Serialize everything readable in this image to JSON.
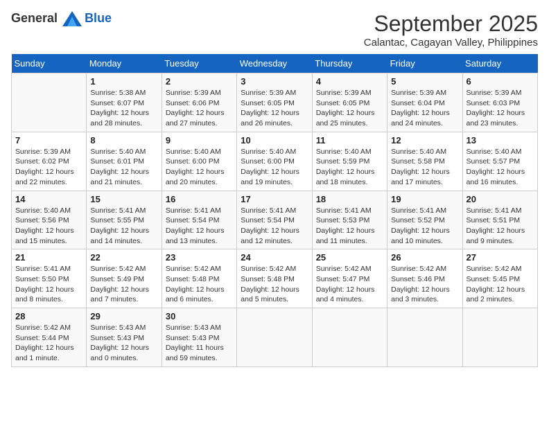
{
  "logo": {
    "line1": "General",
    "line2": "Blue"
  },
  "title": "September 2025",
  "subtitle": "Calantac, Cagayan Valley, Philippines",
  "days_of_week": [
    "Sunday",
    "Monday",
    "Tuesday",
    "Wednesday",
    "Thursday",
    "Friday",
    "Saturday"
  ],
  "weeks": [
    [
      null,
      {
        "day": 1,
        "sunrise": "5:38 AM",
        "sunset": "6:07 PM",
        "daylight": "12 hours and 28 minutes."
      },
      {
        "day": 2,
        "sunrise": "5:39 AM",
        "sunset": "6:06 PM",
        "daylight": "12 hours and 27 minutes."
      },
      {
        "day": 3,
        "sunrise": "5:39 AM",
        "sunset": "6:05 PM",
        "daylight": "12 hours and 26 minutes."
      },
      {
        "day": 4,
        "sunrise": "5:39 AM",
        "sunset": "6:05 PM",
        "daylight": "12 hours and 25 minutes."
      },
      {
        "day": 5,
        "sunrise": "5:39 AM",
        "sunset": "6:04 PM",
        "daylight": "12 hours and 24 minutes."
      },
      {
        "day": 6,
        "sunrise": "5:39 AM",
        "sunset": "6:03 PM",
        "daylight": "12 hours and 23 minutes."
      }
    ],
    [
      {
        "day": 7,
        "sunrise": "5:39 AM",
        "sunset": "6:02 PM",
        "daylight": "12 hours and 22 minutes."
      },
      {
        "day": 8,
        "sunrise": "5:40 AM",
        "sunset": "6:01 PM",
        "daylight": "12 hours and 21 minutes."
      },
      {
        "day": 9,
        "sunrise": "5:40 AM",
        "sunset": "6:00 PM",
        "daylight": "12 hours and 20 minutes."
      },
      {
        "day": 10,
        "sunrise": "5:40 AM",
        "sunset": "6:00 PM",
        "daylight": "12 hours and 19 minutes."
      },
      {
        "day": 11,
        "sunrise": "5:40 AM",
        "sunset": "5:59 PM",
        "daylight": "12 hours and 18 minutes."
      },
      {
        "day": 12,
        "sunrise": "5:40 AM",
        "sunset": "5:58 PM",
        "daylight": "12 hours and 17 minutes."
      },
      {
        "day": 13,
        "sunrise": "5:40 AM",
        "sunset": "5:57 PM",
        "daylight": "12 hours and 16 minutes."
      }
    ],
    [
      {
        "day": 14,
        "sunrise": "5:40 AM",
        "sunset": "5:56 PM",
        "daylight": "12 hours and 15 minutes."
      },
      {
        "day": 15,
        "sunrise": "5:41 AM",
        "sunset": "5:55 PM",
        "daylight": "12 hours and 14 minutes."
      },
      {
        "day": 16,
        "sunrise": "5:41 AM",
        "sunset": "5:54 PM",
        "daylight": "12 hours and 13 minutes."
      },
      {
        "day": 17,
        "sunrise": "5:41 AM",
        "sunset": "5:54 PM",
        "daylight": "12 hours and 12 minutes."
      },
      {
        "day": 18,
        "sunrise": "5:41 AM",
        "sunset": "5:53 PM",
        "daylight": "12 hours and 11 minutes."
      },
      {
        "day": 19,
        "sunrise": "5:41 AM",
        "sunset": "5:52 PM",
        "daylight": "12 hours and 10 minutes."
      },
      {
        "day": 20,
        "sunrise": "5:41 AM",
        "sunset": "5:51 PM",
        "daylight": "12 hours and 9 minutes."
      }
    ],
    [
      {
        "day": 21,
        "sunrise": "5:41 AM",
        "sunset": "5:50 PM",
        "daylight": "12 hours and 8 minutes."
      },
      {
        "day": 22,
        "sunrise": "5:42 AM",
        "sunset": "5:49 PM",
        "daylight": "12 hours and 7 minutes."
      },
      {
        "day": 23,
        "sunrise": "5:42 AM",
        "sunset": "5:48 PM",
        "daylight": "12 hours and 6 minutes."
      },
      {
        "day": 24,
        "sunrise": "5:42 AM",
        "sunset": "5:48 PM",
        "daylight": "12 hours and 5 minutes."
      },
      {
        "day": 25,
        "sunrise": "5:42 AM",
        "sunset": "5:47 PM",
        "daylight": "12 hours and 4 minutes."
      },
      {
        "day": 26,
        "sunrise": "5:42 AM",
        "sunset": "5:46 PM",
        "daylight": "12 hours and 3 minutes."
      },
      {
        "day": 27,
        "sunrise": "5:42 AM",
        "sunset": "5:45 PM",
        "daylight": "12 hours and 2 minutes."
      }
    ],
    [
      {
        "day": 28,
        "sunrise": "5:42 AM",
        "sunset": "5:44 PM",
        "daylight": "12 hours and 1 minute."
      },
      {
        "day": 29,
        "sunrise": "5:43 AM",
        "sunset": "5:43 PM",
        "daylight": "12 hours and 0 minutes."
      },
      {
        "day": 30,
        "sunrise": "5:43 AM",
        "sunset": "5:43 PM",
        "daylight": "11 hours and 59 minutes."
      },
      null,
      null,
      null,
      null
    ]
  ]
}
